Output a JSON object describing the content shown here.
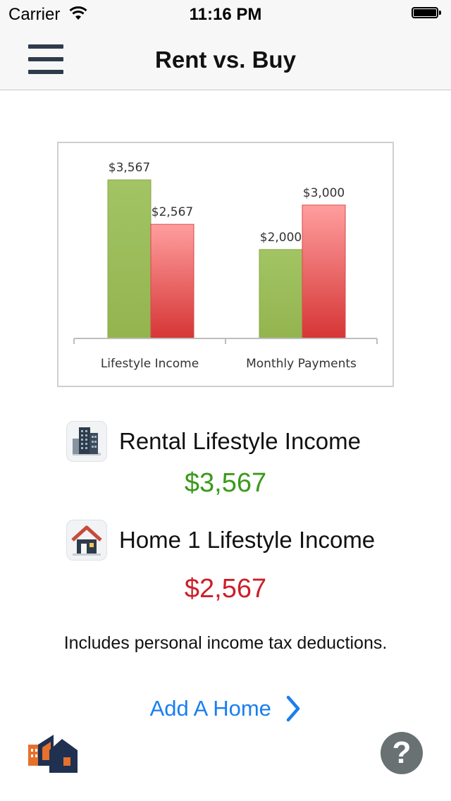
{
  "status_bar": {
    "carrier": "Carrier",
    "time": "11:16 PM"
  },
  "nav": {
    "title": "Rent vs. Buy",
    "menu_icon": "hamburger-menu-icon"
  },
  "chart_data": {
    "type": "bar",
    "categories": [
      "Lifestyle Income",
      "Monthly Payments"
    ],
    "series": [
      {
        "values": [
          3567,
          2000
        ],
        "color": "#9bbb59"
      },
      {
        "values": [
          2567,
          3000
        ],
        "color": "#e05a5a"
      }
    ],
    "data_labels": [
      [
        "$3,567",
        "$2,000"
      ],
      [
        "$2,567",
        "$3,000"
      ]
    ],
    "ylim": [
      0,
      3600
    ],
    "grid": false,
    "legend": "none"
  },
  "rental": {
    "label": "Rental Lifestyle Income",
    "value": "$3,567",
    "value_color": "#3a9a1a",
    "icon": "apartment-building-icon"
  },
  "home": {
    "label": "Home 1 Lifestyle Income",
    "value": "$2,567",
    "value_color": "#cc1f2a",
    "icon": "house-icon"
  },
  "note": "Includes personal income tax deductions.",
  "add_home": {
    "label": "Add A Home",
    "color": "#1a7ef0",
    "icon": "chevron-right-icon"
  },
  "footer": {
    "logo_icon": "buildings-logo-icon",
    "help_label": "?"
  }
}
